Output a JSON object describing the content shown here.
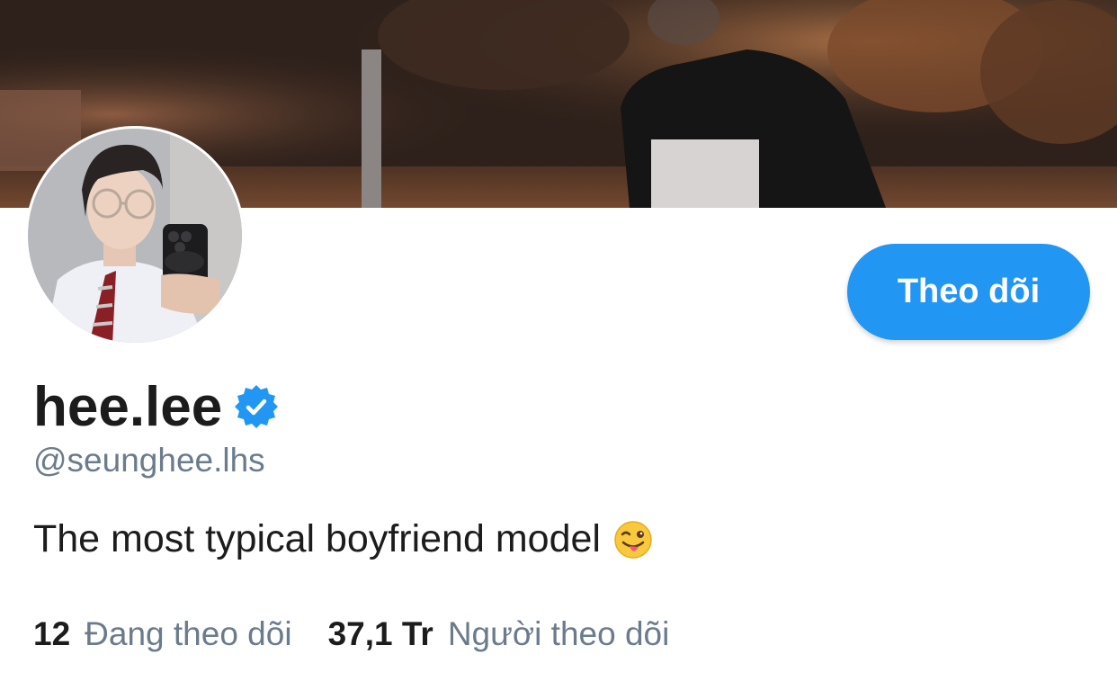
{
  "profile": {
    "display_name": "hee.lee",
    "handle": "@seunghee.lhs",
    "bio": "The most typical boyfriend model",
    "bio_emoji": "winking-face-with-tongue-icon",
    "verified": true
  },
  "actions": {
    "follow_label": "Theo dõi"
  },
  "stats": {
    "following_count": "12",
    "following_label": "Đang theo dõi",
    "followers_count": "37,1 Tr",
    "followers_label": "Người theo dõi"
  },
  "colors": {
    "accent": "#2196f3",
    "text_primary": "#1c1c1c",
    "text_secondary": "#6b7b8c"
  }
}
